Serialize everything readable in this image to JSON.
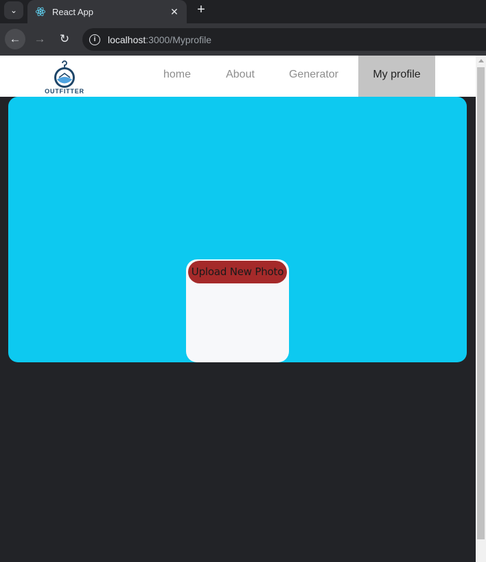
{
  "browser": {
    "tab_title": "React App",
    "url_host": "localhost",
    "url_path": ":3000/Myprofile"
  },
  "site": {
    "logo_text": "OUTFITTER",
    "nav": {
      "home": "home",
      "about": "About",
      "generator": "Generator",
      "profile": "My profile"
    }
  },
  "profile": {
    "upload_label": "Upload New Photo"
  },
  "colors": {
    "hero": "#0dc9f0",
    "upload_button": "#a52a2a",
    "active_nav": "#c4c4c4",
    "page_bg": "#222327"
  }
}
